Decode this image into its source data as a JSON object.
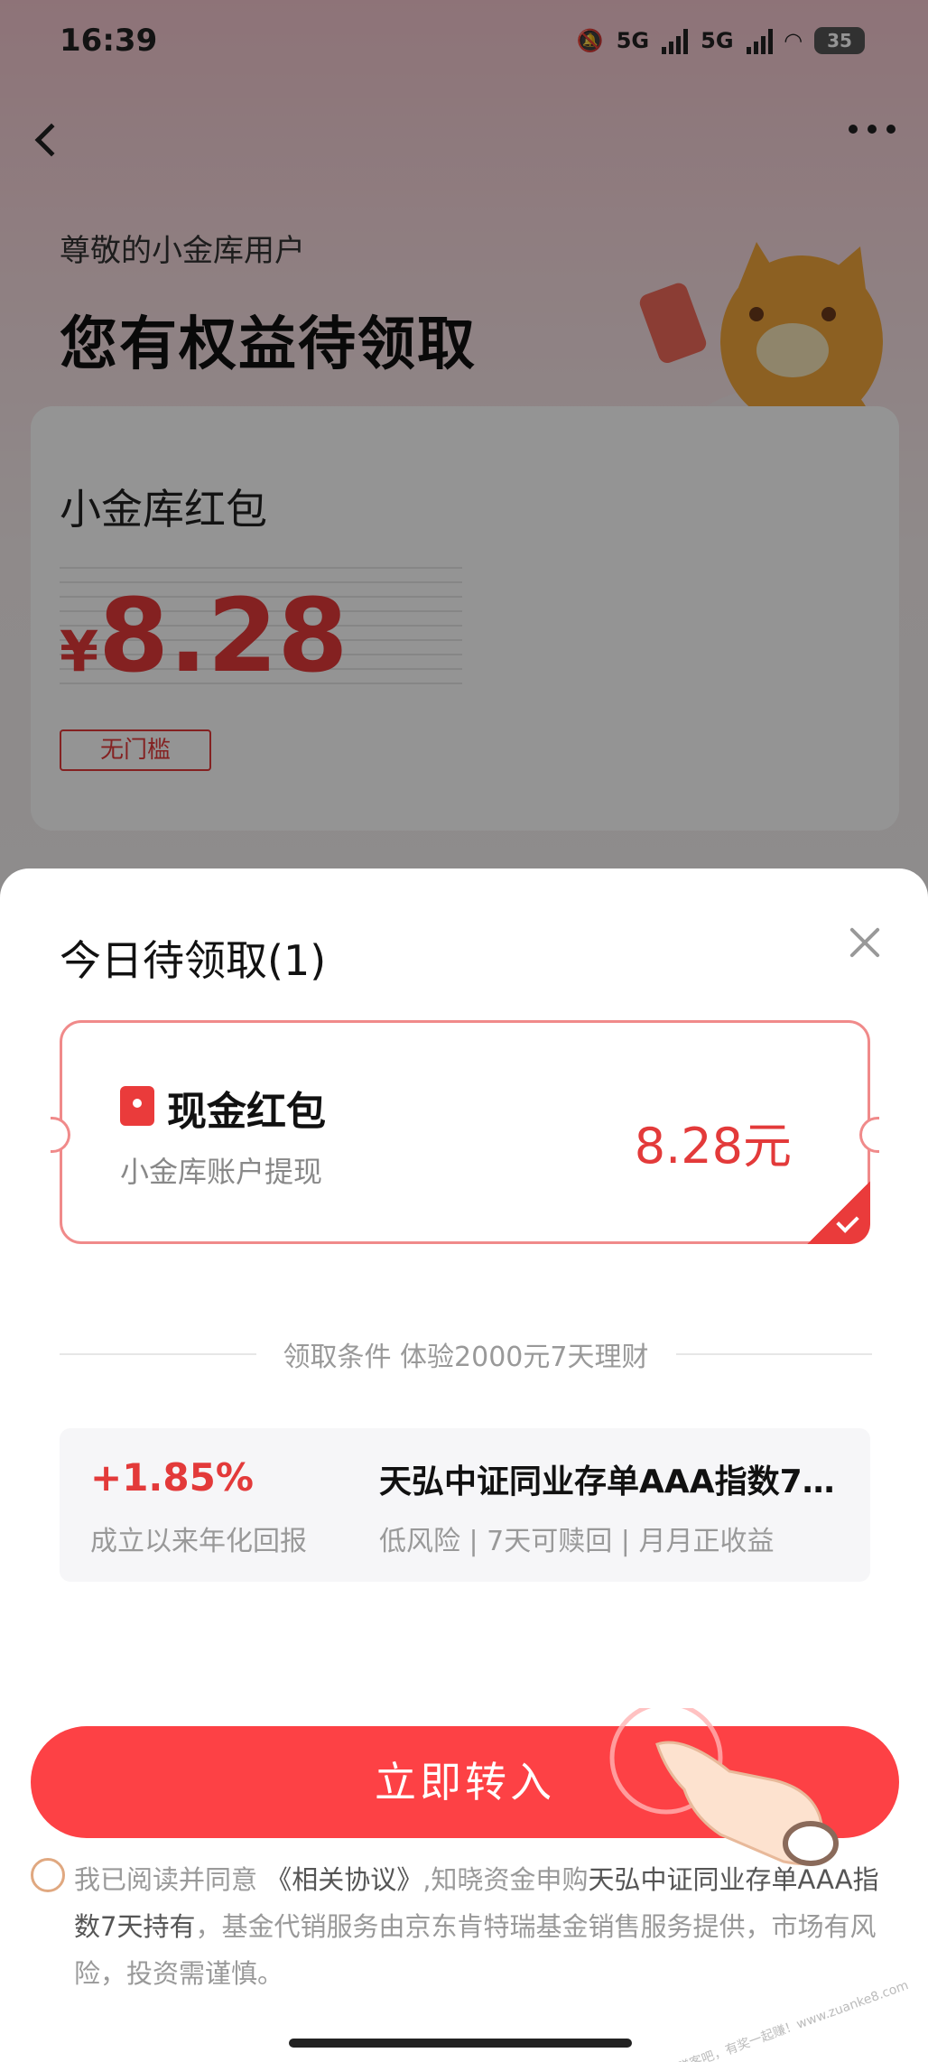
{
  "status_bar": {
    "time": "16:39",
    "network_1": "5G",
    "network_2": "5G",
    "battery": "35"
  },
  "header": {
    "greeting": "尊敬的小金库用户",
    "headline": "您有权益待领取"
  },
  "reward_card": {
    "title": "小金库红包",
    "currency_symbol": "¥",
    "amount": "8.28",
    "tag": "无门槛"
  },
  "sheet": {
    "title": "今日待领取(1)",
    "coupon": {
      "title": "现金红包",
      "subtitle": "小金库账户提现",
      "amount": "8.28元"
    },
    "condition": "领取条件  体验2000元7天理财",
    "product": {
      "rate": "+1.85%",
      "rate_label": "成立以来年化回报",
      "name": "天弘中证同业存单AAA指数7天持有",
      "tags": "低风险 | 7天可赎回 | 月月正收益"
    },
    "cta_label": "立即转入",
    "agreement": {
      "prefix": "我已阅读并同意",
      "link": "《相关协议》",
      "middle": ",知晓资金申购",
      "fund": "天弘中证同业存单AAA指数7天持有",
      "suffix": "，基金代销服务由京东肯特瑞基金销售服务提供，市场有风险，投资需谨慎。"
    }
  },
  "watermark": "赚客吧，有奖一起赚！www.zuanke8.com",
  "colors": {
    "accent_red": "#fd4145",
    "amount_red": "#e33a3a"
  }
}
